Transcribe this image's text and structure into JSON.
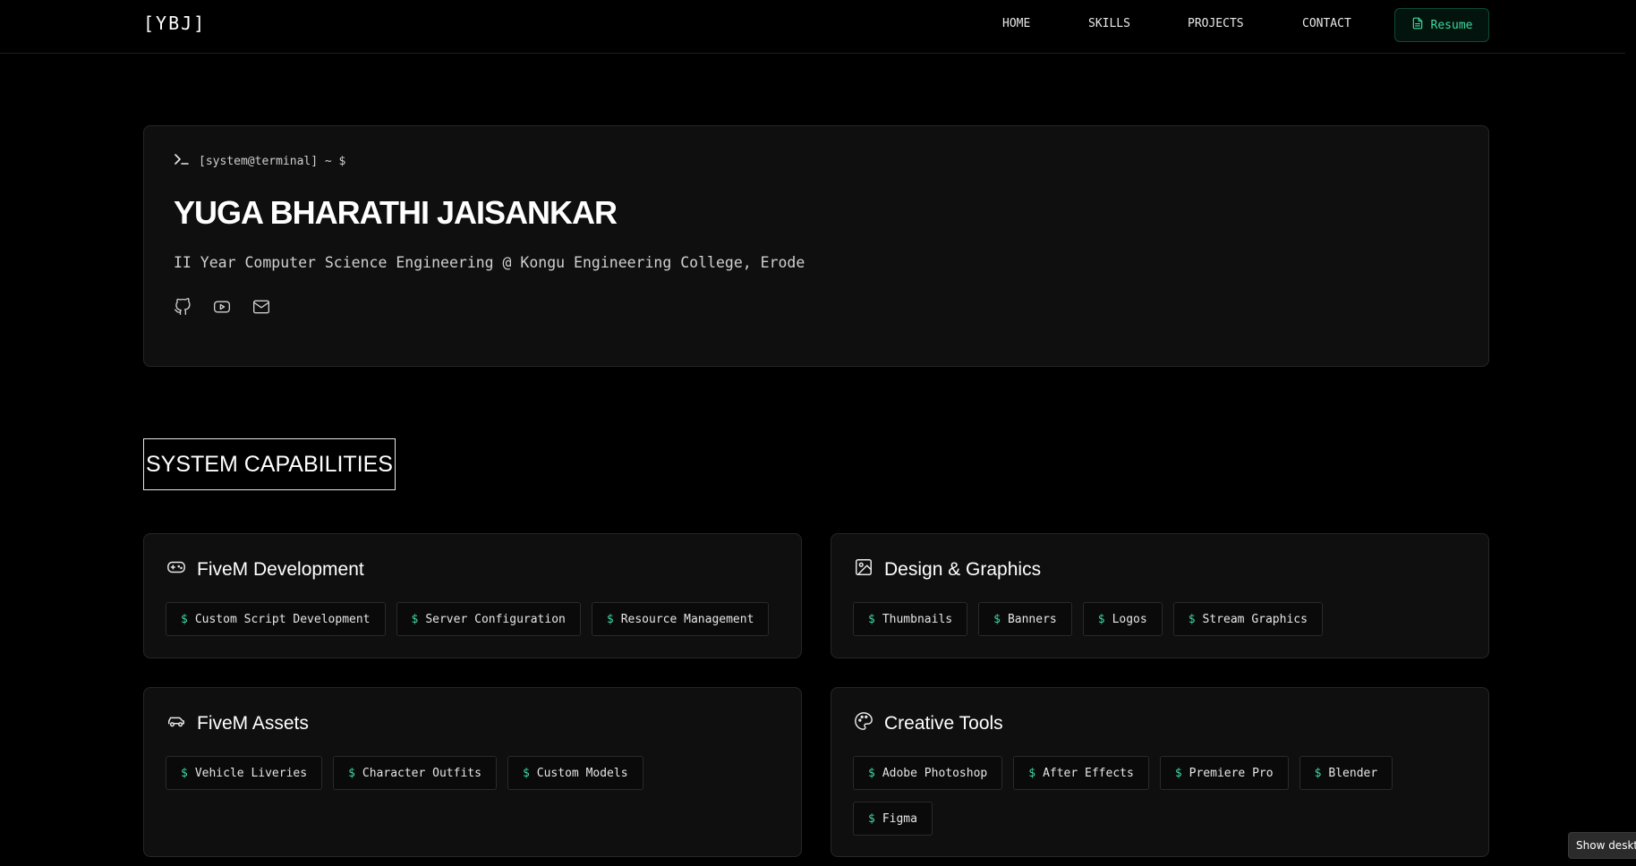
{
  "nav": {
    "logo": "[YBJ]",
    "links": [
      "HOME",
      "SKILLS",
      "PROJECTS",
      "CONTACT"
    ],
    "resume_label": "Resume"
  },
  "hero": {
    "prompt": "[system@terminal] ~ $",
    "name": "YUGA BHARATHI JAISANKAR",
    "subtitle": "II Year Computer Science Engineering @ Kongu Engineering College, Erode",
    "socials": [
      "github-icon",
      "youtube-icon",
      "mail-icon"
    ]
  },
  "capabilities": {
    "title": "SYSTEM CAPABILITIES",
    "cards": [
      {
        "icon": "gamepad-icon",
        "title": "FiveM Development",
        "tags": [
          "Custom Script Development",
          "Server Configuration",
          "Resource Management"
        ]
      },
      {
        "icon": "image-icon",
        "title": "Design & Graphics",
        "tags": [
          "Thumbnails",
          "Banners",
          "Logos",
          "Stream Graphics"
        ]
      },
      {
        "icon": "car-icon",
        "title": "FiveM Assets",
        "tags": [
          "Vehicle Liveries",
          "Character Outfits",
          "Custom Models"
        ]
      },
      {
        "icon": "palette-icon",
        "title": "Creative Tools",
        "tags": [
          "Adobe Photoshop",
          "After Effects",
          "Premiere Pro",
          "Blender",
          "Figma"
        ]
      }
    ],
    "tag_prefix": "$"
  },
  "tooltip": "Show desktop",
  "colors": {
    "accent": "#3ed89f",
    "background": "#000000",
    "card": "#0f0f0f",
    "border": "#262626"
  }
}
